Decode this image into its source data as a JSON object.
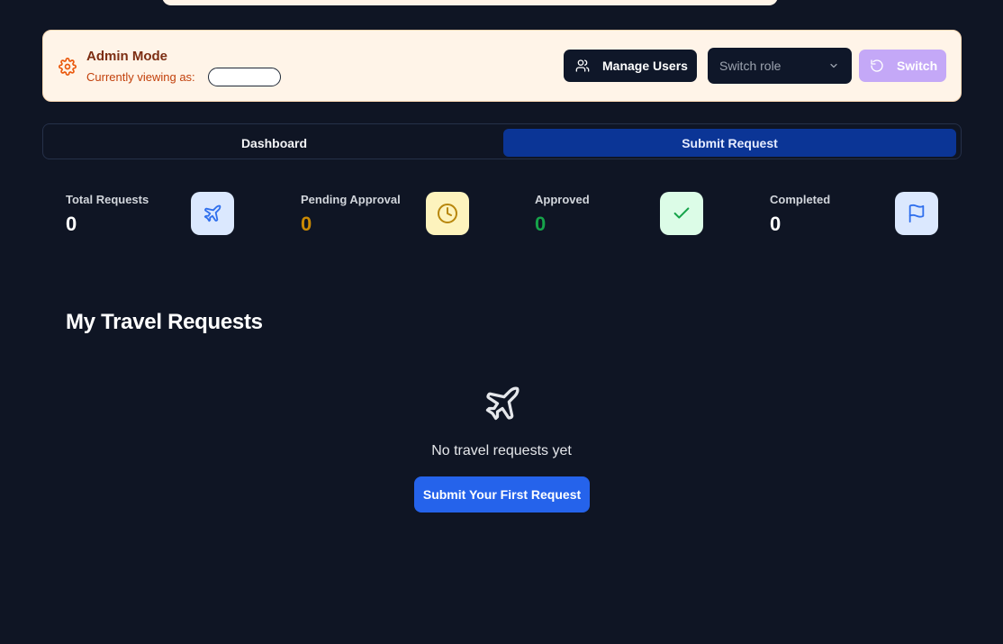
{
  "admin_bar": {
    "title": "Admin Mode",
    "viewing_label": "Currently viewing as:",
    "viewing_role": "",
    "manage_users_label": "Manage Users",
    "role_select_placeholder": "Switch role",
    "switch_label": "Switch"
  },
  "tabs": [
    {
      "label": "Dashboard",
      "active": false
    },
    {
      "label": "Submit Request",
      "active": true
    }
  ],
  "stats": [
    {
      "label": "Total Requests",
      "value": "0",
      "icon": "plane-icon",
      "value_color": "#ffffff",
      "icon_bg": "#dbe8fe",
      "icon_color": "#2f6fed"
    },
    {
      "label": "Pending Approval",
      "value": "0",
      "icon": "clock-icon",
      "value_color": "#ca8a04",
      "icon_bg": "#fdf3bd",
      "icon_color": "#b7860b"
    },
    {
      "label": "Approved",
      "value": "0",
      "icon": "check-icon",
      "value_color": "#16a34a",
      "icon_bg": "#dcfce7",
      "icon_color": "#16a34a"
    },
    {
      "label": "Completed",
      "value": "0",
      "icon": "flag-icon",
      "value_color": "#ffffff",
      "icon_bg": "#dbe8fe",
      "icon_color": "#2f6fed"
    }
  ],
  "main": {
    "section_title": "My Travel Requests",
    "empty_text": "No travel requests yet",
    "cta_label": "Submit Your First Request"
  },
  "colors": {
    "background": "#0f1524",
    "admin_bg": "#fff4e8",
    "primary": "#2563eb",
    "active_tab": "#0b3596",
    "switch_bg": "#c4a8f7"
  }
}
